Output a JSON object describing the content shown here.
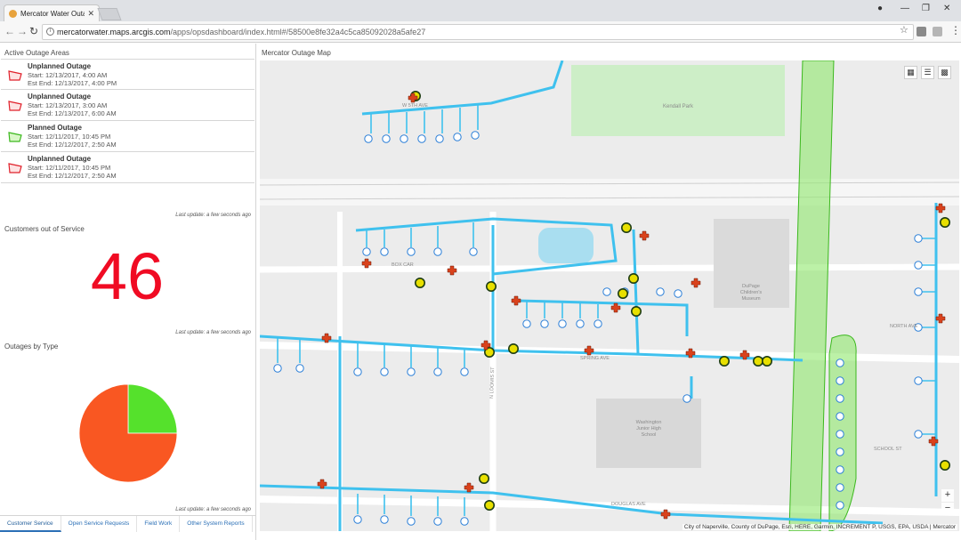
{
  "browser": {
    "tab_title": "Mercator Water Outage",
    "tab_close": "✕",
    "url_host": "mercatorwater.maps.arcgis.com",
    "url_path": "/apps/opsdashboard/index.html#/58500e8fe32a4c5ca85092028a5afe27",
    "back_icon": "back-arrow-icon",
    "forward_icon": "forward-arrow-icon",
    "reload_icon": "reload-icon"
  },
  "outages": {
    "title": "Active Outage Areas",
    "items": [
      {
        "name": "Unplanned Outage",
        "start": "Start:  12/13/2017, 4:00 AM",
        "end": "Est End: 12/13/2017, 4:00 PM",
        "color": "#e0202a",
        "fill": "#fde3e3"
      },
      {
        "name": "Unplanned Outage",
        "start": "Start:  12/13/2017, 3:00 AM",
        "end": "Est End: 12/13/2017, 6:00 AM",
        "color": "#e0202a",
        "fill": "#fde3e3"
      },
      {
        "name": "Planned Outage",
        "start": "Start:  12/11/2017, 10:45 PM",
        "end": "Est End: 12/12/2017, 2:50 AM",
        "color": "#3cb81e",
        "fill": "#d9f7c8"
      },
      {
        "name": "Unplanned Outage",
        "start": "Start:  12/11/2017, 10:45 PM",
        "end": "Est End: 12/12/2017, 2:50 AM",
        "color": "#e0202a",
        "fill": "#fde3e3"
      }
    ],
    "last_update": "Last update: a few seconds ago"
  },
  "customers": {
    "title": "Customers out of Service",
    "count": "46",
    "count_color": "#f00b23",
    "last_update": "Last update: a few seconds ago"
  },
  "by_type": {
    "title": "Outages by Type",
    "last_update": "Last update: a few seconds ago"
  },
  "chart_data": {
    "type": "pie",
    "title": "Outages by Type",
    "slices": [
      {
        "label": "",
        "value": 25,
        "color": "#55e12c"
      },
      {
        "label": "",
        "value": 75,
        "color": "#f95722"
      }
    ]
  },
  "bottom_tabs": [
    "Customer Service",
    "Open Service Requests",
    "Field Work",
    "Other System Reports"
  ],
  "map": {
    "title": "Mercator Outage Map",
    "park_label": "Kendall Park",
    "museum_label_1": "DuPage",
    "museum_label_2": "Children's",
    "museum_label_3": "Museum",
    "school_label_1": "Washington",
    "school_label_2": "Junior High",
    "school_label_3": "School",
    "streets": [
      "W 5TH AVE",
      "BOX CAR",
      "NORTH AVE",
      "DOUGLAS AVE",
      "SPRING AVE",
      "SCHOOL ST",
      "N LOOMIS ST"
    ],
    "attribution": "City of Naperville, County of DuPage, Esri, HERE, Garmin, INCREMENT P, USGS, EPA, USDA | Mercator",
    "zoom_in": "+",
    "zoom_out": "−",
    "pipe_color": "#3fc1ee",
    "outage_area_color": "#7fe35a",
    "valve_color": "#e8e000",
    "incident_color": "#d9421c"
  }
}
